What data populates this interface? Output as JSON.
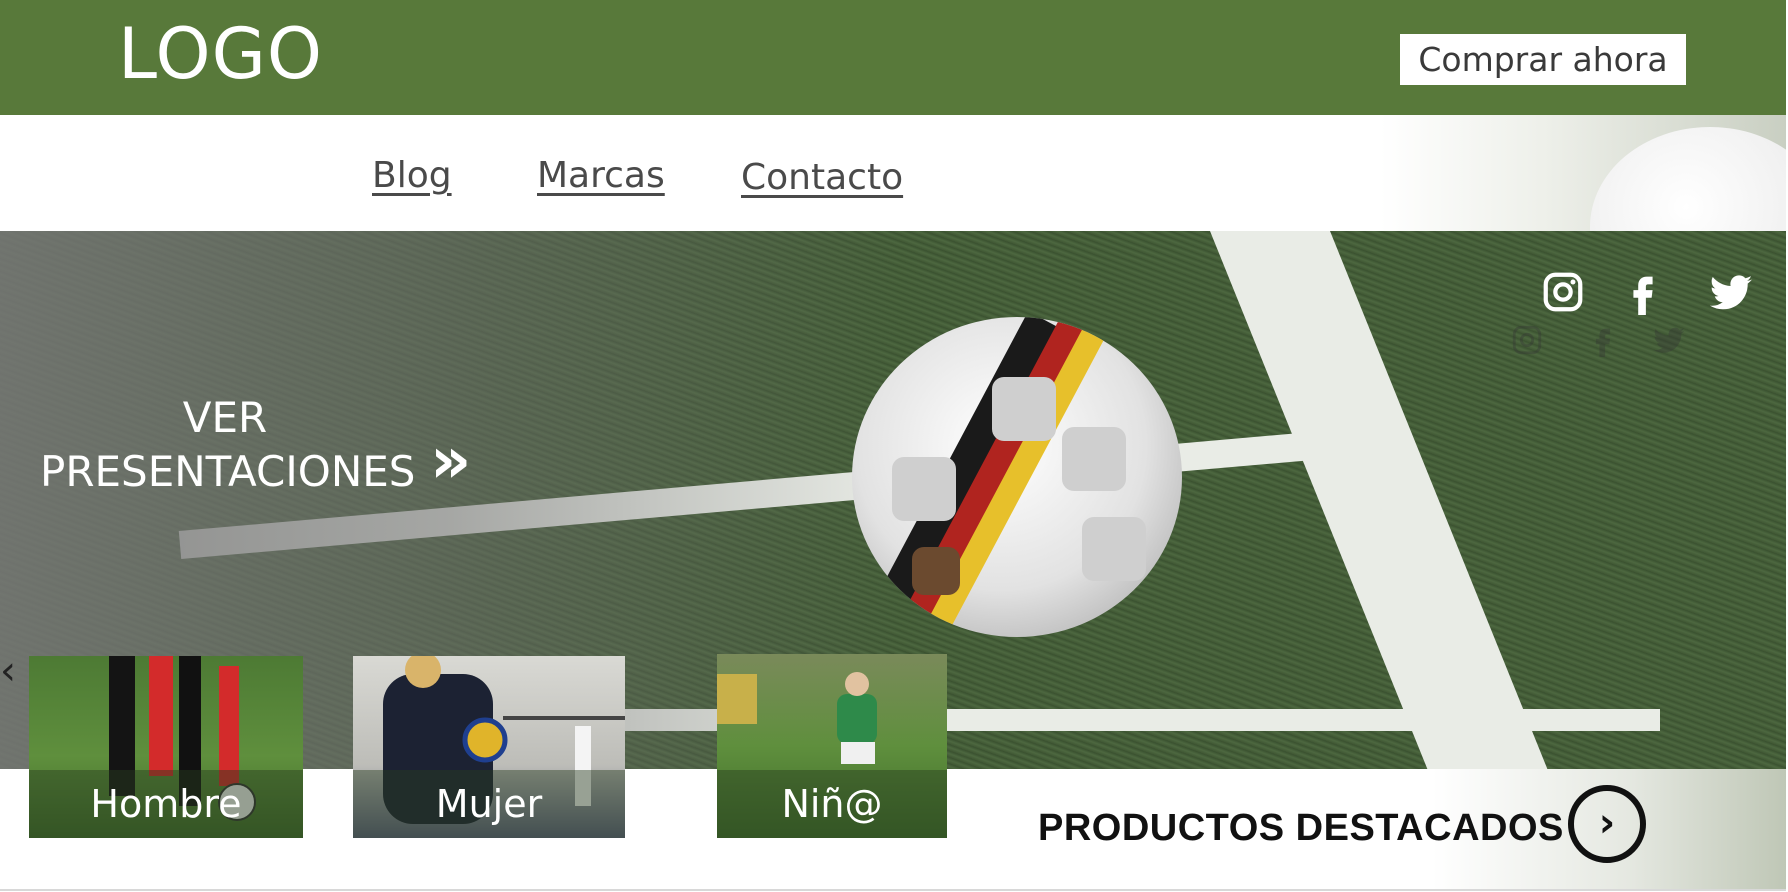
{
  "header": {
    "logo": "LOGO",
    "buy_button": "Comprar ahora"
  },
  "nav": {
    "items": [
      {
        "label": "Blog"
      },
      {
        "label": "Marcas"
      },
      {
        "label": "Contacto"
      }
    ]
  },
  "hero": {
    "cta_line1": "VER",
    "cta_line2": "PRESENTACIONES",
    "cta_icon": "double-chevron-right-icon",
    "social": [
      {
        "name": "instagram-icon"
      },
      {
        "name": "facebook-icon"
      },
      {
        "name": "twitter-icon"
      }
    ]
  },
  "categories": [
    {
      "label": "Hombre"
    },
    {
      "label": "Mujer"
    },
    {
      "label": "Niñ@"
    }
  ],
  "featured": {
    "label": "PRODUCTOS DESTACADOS",
    "icon": "chevron-right-circle-icon"
  },
  "colors": {
    "brand_green": "#58793a",
    "white": "#ffffff"
  }
}
